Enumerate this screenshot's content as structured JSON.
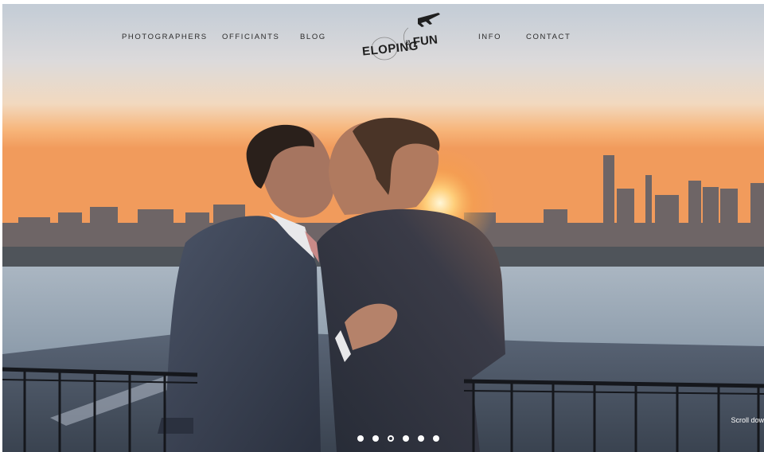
{
  "nav": {
    "left": [
      "PHOTOGRAPHERS",
      "OFFICIANTS",
      "BLOG"
    ],
    "right": [
      "INFO",
      "CONTACT"
    ]
  },
  "logo": {
    "word_left": "ELOPING",
    "word_mid": "IS",
    "word_right": "FUN",
    "icon": "airplane-icon"
  },
  "hero": {
    "scroll_label": "Scroll dow",
    "slides_total": 6,
    "active_slide": 3
  },
  "colors": {
    "sky_top": "#c3ccd6",
    "sunset": "#f6a35c",
    "sun": "#ffd98a",
    "water": "#a7b4c0",
    "suit": "#2f3645"
  }
}
